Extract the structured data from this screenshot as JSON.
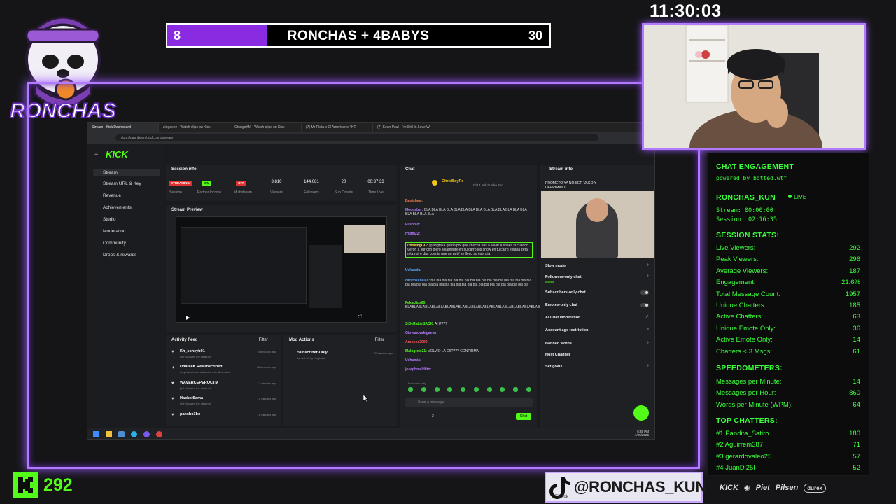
{
  "clock": "11:30:03",
  "logo": {
    "text": "RONCHAS"
  },
  "scoreboard": {
    "left_score": "8",
    "title": "RONCHAS + 4BABYS",
    "right_score": "30",
    "progress_fraction": 0.26,
    "fill_color": "#8a2be2"
  },
  "browser": {
    "tabs": [
      "Stream - Kick Dashboard",
      "zingaeez - Watch clips on Kick",
      "OtongoYM - Watch clips on Kick",
      "(7) Mr Plata x El Americano 4KT",
      "(7) Sean Paul - I'm Still In Love W"
    ],
    "url": "https://dashboard.kick.com/stream"
  },
  "kick": {
    "logo": "KICK",
    "nav": [
      "Stream",
      "Stream URL & Key",
      "Revenue",
      "Achievements",
      "Studio",
      "Moderation",
      "Community",
      "Drops & rewards"
    ],
    "session": {
      "title": "Session info",
      "badges": [
        "STREAMING",
        "ON",
        "OFF"
      ],
      "badge_labels": [
        "Session",
        "Partner Income",
        "Multistream"
      ],
      "stats": [
        {
          "value": "3,810",
          "label": "Viewers"
        },
        {
          "value": "144,081",
          "label": "Followers"
        },
        {
          "value": "20",
          "label": "Sub Counts"
        },
        {
          "value": "00:37:33",
          "label": "Time Live"
        }
      ]
    },
    "preview_title": "Stream Preview",
    "activity": {
      "title": "Activity Feed",
      "filter": "Filter",
      "items": [
        {
          "name": "Kh_soheyb01",
          "sub": "just followed the channel",
          "time": "4 seconds ago"
        },
        {
          "name": "DhareeK Resubscribed!",
          "sub": "they have been subscribed for 8 months",
          "time": "48 seconds ago"
        },
        {
          "name": "WAVERCEPEROCTM",
          "sub": "just followed the channel",
          "time": "2 minutes ago"
        },
        {
          "name": "HackerSama",
          "sub": "just followed the channel",
          "time": "10 minutes ago"
        },
        {
          "name": "pancho3bo",
          "sub": "",
          "time": "16 minutes ago"
        }
      ]
    },
    "mod": {
      "title": "Mod Actions",
      "filter": "Filter",
      "item": "Subscriber-Only",
      "item_sub": "turned off by Kingteka",
      "item_time": "27 minutes ago"
    },
    "chat": {
      "title": "Chat",
      "pinned_user": "ChrisBoyPe",
      "pinned_text": "Gift 1 sub to take 2nd",
      "lines": [
        {
          "user": "Banisheer:",
          "text": "",
          "color": "#ff7a45"
        },
        {
          "user": "Moodaber:",
          "text": "BLA BLA BLA BLA BLA BLA BLA BLA BLA BLA BLA BLA BLA BLA BLA BLA BLA BLA",
          "color": "#b57bff"
        },
        {
          "user": "Ellsobio:",
          "text": "",
          "color": "#b57bff"
        },
        {
          "user": "rmdm22:",
          "text": "",
          "color": "#b57bff"
        },
        {
          "user": "ZmokingGG:",
          "text": "@kingteka gordo por que chucha vas a llevar a shaka si cuando fueron a sur con piero solamente en su carro los show en tu carro estaba zeta zeta not e das cuenta que un put# se llevo su esencia",
          "color": "#ffdd55"
        },
        {
          "user": "Ushumia:",
          "text": "",
          "color": "#5aa8ff"
        },
        {
          "user": "carlitoschalas:",
          "text": "bla bla bla bla bla bla bla bla bla bla bla bla bla bla bla bla bla bla bla bla bla bla bla bla bla bla bla bla bla bla bla bla bla bla bla bla bla bla bla bla",
          "color": "#5aa8ff"
        },
        {
          "user": "Fekaclips00:",
          "text": "BLABLABLABLABLABLABLABLABLABLABLABLABLABLABLABLABLABLABLABLABLABLABLABLABLA",
          "color": "#53fc18"
        },
        {
          "user": "SiDeRaLisBACK:",
          "text": "AH????",
          "color": "#53fc18"
        },
        {
          "user": "Giovanovskigamer:",
          "text": "",
          "color": "#b57bff"
        },
        {
          "user": "Aroosso2000:",
          "text": "",
          "color": "#ff5555"
        },
        {
          "user": "Malogrete21:",
          "text": "VOLVIO LA G5???? CONFIRMA",
          "color": "#53fc18"
        },
        {
          "user": "Ushumia:",
          "text": "",
          "color": "#b57bff"
        },
        {
          "user": "josephmalditto:",
          "text": "",
          "color": "#b57bff"
        }
      ],
      "followers_only": "Followers only",
      "input_placeholder": "Send a message",
      "send_label": "Chat",
      "points": "2"
    },
    "stream_info": {
      "title": "Stream info",
      "stream_title": "PROMETO YA NO SER VAGO Y DEPRIMIDO",
      "settings": [
        {
          "label": "Slow mode",
          "kind": "chevron"
        },
        {
          "label": "Followers-only chat",
          "sub": "Instant",
          "kind": "chevron"
        },
        {
          "label": "Subscribers-only chat",
          "kind": "toggle"
        },
        {
          "label": "Emotes-only chat",
          "kind": "toggle"
        },
        {
          "label": "AI Chat Moderation",
          "kind": "link"
        },
        {
          "label": "Account age restriction",
          "kind": "chevron"
        },
        {
          "label": "Banned words",
          "kind": "chevron"
        },
        {
          "label": "Host Channel",
          "kind": "none"
        },
        {
          "label": "Set goals",
          "kind": "chevron"
        }
      ]
    },
    "taskbar_time": "6:35 PM",
    "taskbar_date": "1/25/2026"
  },
  "engagement": {
    "title": "CHAT ENGAGEMENT",
    "powered": "powered by botted.wtf",
    "channel": "RONCHAS_KUN",
    "live": "LIVE",
    "stream_time": "Stream: 00:00:00",
    "session_time": "Session: 02:16:35",
    "session_header": "SESSION STATS:",
    "session_stats": [
      {
        "label": "Live Viewers:",
        "value": "292"
      },
      {
        "label": "Peak Viewers:",
        "value": "296"
      },
      {
        "label": "Average Viewers:",
        "value": "187"
      },
      {
        "label": "Engagement:",
        "value": "21.6%"
      },
      {
        "label": "Total Message Count:",
        "value": "1957"
      },
      {
        "label": "Unique Chatters:",
        "value": "185"
      },
      {
        "label": "Active Chatters:",
        "value": "63"
      },
      {
        "label": "Unique Emote Only:",
        "value": "36"
      },
      {
        "label": "Active Emote Only:",
        "value": "14"
      },
      {
        "label": "Chatters < 3 Msgs:",
        "value": "61"
      }
    ],
    "speed_header": "SPEEDOMETERS:",
    "speed_stats": [
      {
        "label": "Messages per Minute:",
        "value": "14"
      },
      {
        "label": "Messages per Hour:",
        "value": "860"
      },
      {
        "label": "Words per Minute (WPM):",
        "value": "64"
      }
    ],
    "top_header": "TOP CHATTERS:",
    "top_chatters": [
      {
        "label": "#1 Pandita_Satiro",
        "value": "180"
      },
      {
        "label": "#2 Aguirrem387",
        "value": "71"
      },
      {
        "label": "#3 gerardovaleo25",
        "value": "57"
      },
      {
        "label": "#4 JuanDi25l",
        "value": "52"
      }
    ]
  },
  "viewers": "292",
  "tiktok": {
    "handle": "@RONCHAS_KUN",
    "label": "Tik Tok"
  },
  "sponsors": [
    "KICK",
    "Piet",
    "Pilsen",
    "durex"
  ],
  "colors": {
    "kick_green": "#53fc18",
    "neon_purple": "#b27bff",
    "engagement_green": "#3cff3c"
  }
}
